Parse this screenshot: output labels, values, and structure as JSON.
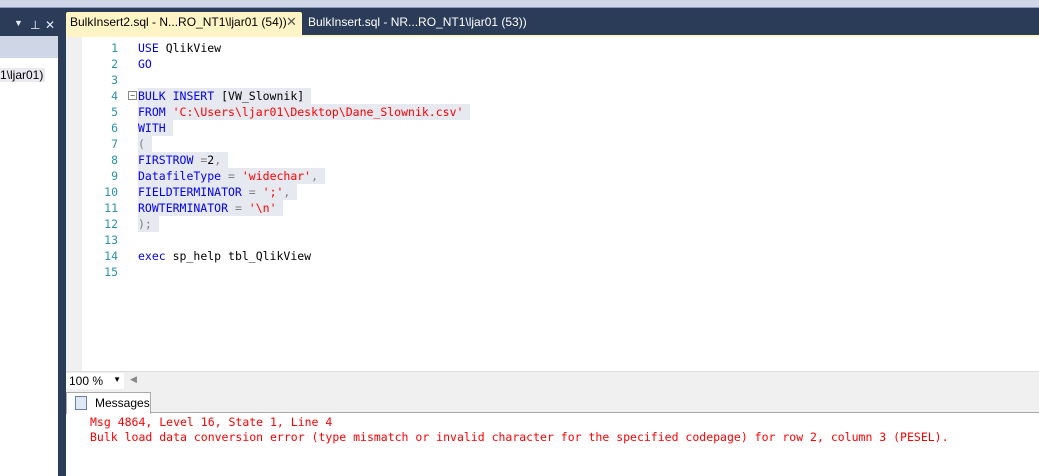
{
  "left_panel": {
    "item": "1\\ljar01)"
  },
  "tabs": [
    {
      "label": "BulkInsert2.sql - N...RO_NT1\\ljar01 (54))",
      "active": true
    },
    {
      "label": "BulkInsert.sql - NR...RO_NT1\\ljar01 (53))",
      "active": false
    }
  ],
  "editor": {
    "lines": [
      {
        "n": "1",
        "hl": false,
        "tokens": [
          {
            "t": "USE",
            "c": "kw"
          },
          {
            "t": " QlikView",
            "c": "id"
          }
        ]
      },
      {
        "n": "2",
        "hl": false,
        "tokens": [
          {
            "t": "GO",
            "c": "kw"
          }
        ]
      },
      {
        "n": "3",
        "hl": false,
        "tokens": []
      },
      {
        "n": "4",
        "hl": true,
        "fold": true,
        "tokens": [
          {
            "t": "BULK INSERT",
            "c": "kw"
          },
          {
            "t": " [VW_Slownik]",
            "c": "id"
          }
        ]
      },
      {
        "n": "5",
        "hl": true,
        "tokens": [
          {
            "t": "FROM",
            "c": "kw"
          },
          {
            "t": " 'C:\\Users\\ljar01\\Desktop\\Dane_Slownik.csv'",
            "c": "str"
          }
        ]
      },
      {
        "n": "6",
        "hl": true,
        "tokens": [
          {
            "t": "WITH",
            "c": "kw"
          }
        ]
      },
      {
        "n": "7",
        "hl": true,
        "tokens": [
          {
            "t": "(",
            "c": "op"
          }
        ]
      },
      {
        "n": "8",
        "hl": true,
        "tokens": [
          {
            "t": "FIRSTROW",
            "c": "kw"
          },
          {
            "t": " =",
            "c": "op"
          },
          {
            "t": "2",
            "c": "id"
          },
          {
            "t": ",",
            "c": "op"
          }
        ]
      },
      {
        "n": "9",
        "hl": true,
        "tokens": [
          {
            "t": "DatafileType",
            "c": "kw"
          },
          {
            "t": " = ",
            "c": "op"
          },
          {
            "t": "'widechar'",
            "c": "str"
          },
          {
            "t": ",",
            "c": "op"
          }
        ]
      },
      {
        "n": "10",
        "hl": true,
        "tokens": [
          {
            "t": "FIELDTERMINATOR",
            "c": "kw"
          },
          {
            "t": " = ",
            "c": "op"
          },
          {
            "t": "';'",
            "c": "str"
          },
          {
            "t": ",",
            "c": "op"
          }
        ]
      },
      {
        "n": "11",
        "hl": true,
        "tokens": [
          {
            "t": "ROWTERMINATOR",
            "c": "kw"
          },
          {
            "t": " = ",
            "c": "op"
          },
          {
            "t": "'\\n'",
            "c": "str"
          }
        ]
      },
      {
        "n": "12",
        "hl": true,
        "tokens": [
          {
            "t": ");",
            "c": "op"
          }
        ]
      },
      {
        "n": "13",
        "hl": false,
        "tokens": []
      },
      {
        "n": "14",
        "hl": false,
        "tokens": [
          {
            "t": "exec",
            "c": "kw"
          },
          {
            "t": " sp_help tbl_QlikView",
            "c": "id"
          }
        ]
      },
      {
        "n": "15",
        "hl": false,
        "tokens": []
      }
    ]
  },
  "status": {
    "zoom": "100 %"
  },
  "results": {
    "tab": "Messages",
    "messages": [
      "Msg 4864, Level 16, State 1, Line 4",
      "Bulk load data conversion error (type mismatch or invalid character for the specified codepage) for row 2, column 3 (PESEL)."
    ]
  }
}
